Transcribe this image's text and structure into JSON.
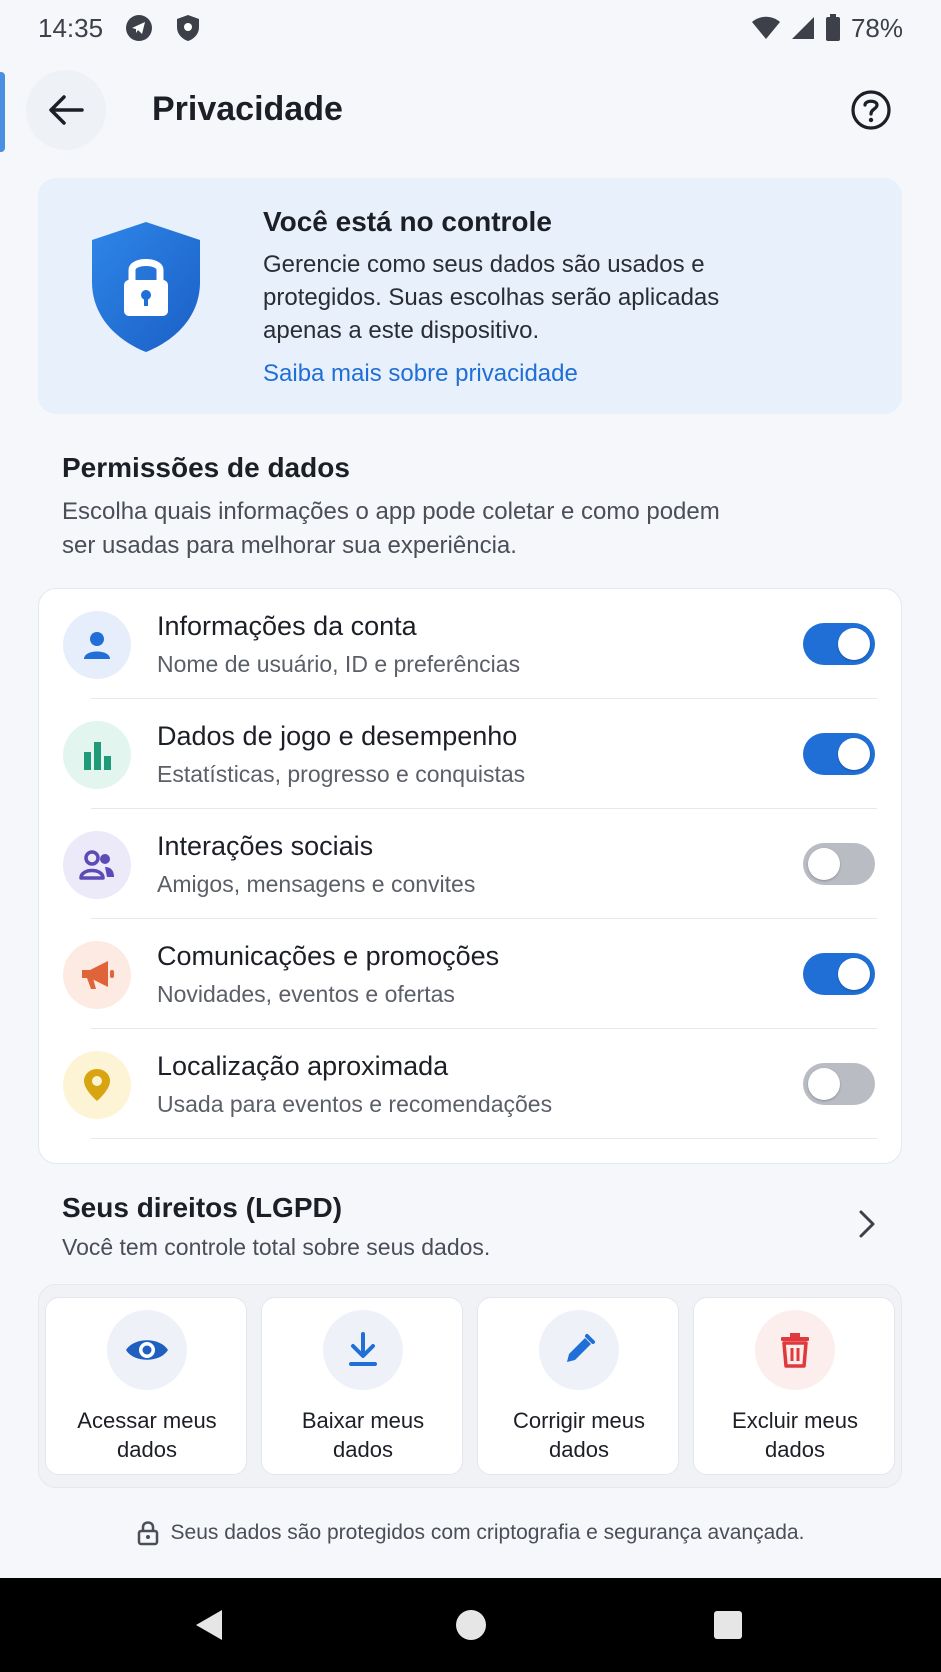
{
  "status_bar": {
    "time": "14:35",
    "battery": "78%",
    "icons": [
      "telegram-icon",
      "shield-icon",
      "wifi-icon",
      "signal-icon",
      "battery-icon"
    ]
  },
  "header": {
    "title": "Privacidade",
    "back_icon": "arrow-left-icon",
    "help_icon": "help-icon"
  },
  "hero": {
    "title": "Você está no controle",
    "text": "Gerencie como seus dados são usados e protegidos. Suas escolhas serão aplicadas apenas a este dispositivo.",
    "link": "Saiba mais sobre privacidade",
    "icon": "shield-lock-icon"
  },
  "permissions": {
    "title": "Permissões de dados",
    "description": "Escolha quais informações o app pode coletar e como podem ser usadas para melhorar sua experiência.",
    "items": [
      {
        "title": "Informações da conta",
        "subtitle": "Nome de usuário, ID e preferências",
        "enabled": true,
        "icon": "user-icon",
        "icon_color": "#1f6fd6",
        "icon_bg": "#e6eefb"
      },
      {
        "title": "Dados de jogo e desempenho",
        "subtitle": "Estatísticas, progresso e conquistas",
        "enabled": true,
        "icon": "bar-chart-icon",
        "icon_color": "#1f9b7a",
        "icon_bg": "#e3f5ef"
      },
      {
        "title": "Interações sociais",
        "subtitle": "Amigos, mensagens e convites",
        "enabled": false,
        "icon": "people-icon",
        "icon_color": "#5b4bb7",
        "icon_bg": "#ece9f8"
      },
      {
        "title": "Comunicações e promoções",
        "subtitle": "Novidades, eventos e ofertas",
        "enabled": true,
        "icon": "megaphone-icon",
        "icon_color": "#e0643a",
        "icon_bg": "#fdebe3"
      },
      {
        "title": "Localização aproximada",
        "subtitle": "Usada para eventos e recomendações",
        "enabled": false,
        "icon": "location-pin-icon",
        "icon_color": "#d9a412",
        "icon_bg": "#fdf4d6"
      }
    ]
  },
  "rights": {
    "title": "Seus direitos (LGPD)",
    "subtitle": "Você tem controle total sobre seus dados.",
    "actions": [
      {
        "label": "Acessar meus\ndados",
        "icon": "eye-icon"
      },
      {
        "label": "Baixar meus\ndados",
        "icon": "download-icon"
      },
      {
        "label": "Corrigir meus\ndados",
        "icon": "pencil-icon"
      },
      {
        "label": "Excluir meus\ndados",
        "icon": "trash-icon"
      }
    ]
  },
  "footer": {
    "note": "Seus dados são protegidos com criptografia e segurança avançada.",
    "icon": "lock-icon"
  },
  "colors": {
    "accent": "#1f6fd6",
    "toggle_off": "#b9bcc3",
    "danger": "#e0383b"
  }
}
